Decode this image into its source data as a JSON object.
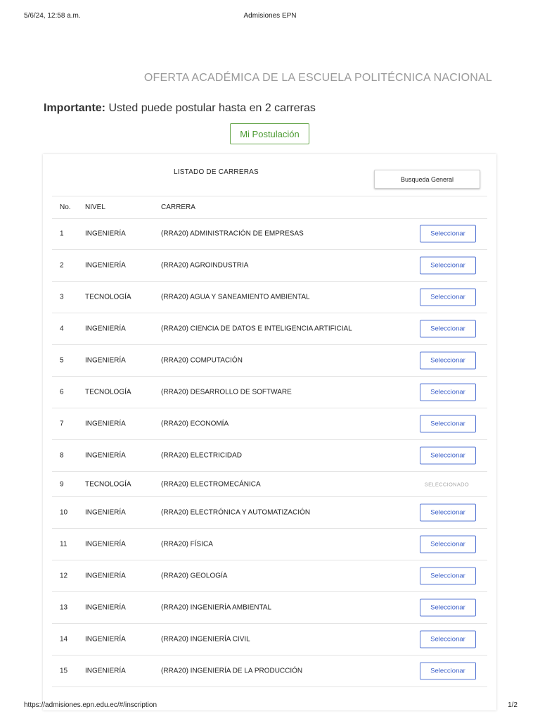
{
  "print_header": {
    "datetime": "5/6/24, 12:58 a.m.",
    "title": "Admisiones EPN"
  },
  "page_heading": "OFERTA ACADÉMICA DE LA ESCUELA POLITÉCNICA NACIONAL",
  "notice": {
    "bold": "Importante:",
    "text": " Usted puede postular hasta en 2 carreras"
  },
  "postulacion_button": "Mi Postulación",
  "card": {
    "title": "LISTADO DE CARRERAS",
    "search_button": "Busqueda General",
    "columns": {
      "no": "No.",
      "nivel": "NIVEL",
      "carrera": "CARRERA"
    },
    "select_label": "Seleccionar",
    "selected_label": "SELECCIONADO",
    "rows": [
      {
        "no": "1",
        "nivel": "INGENIERÍA",
        "carrera": "(RRA20) ADMINISTRACIÓN DE EMPRESAS",
        "selected": false
      },
      {
        "no": "2",
        "nivel": "INGENIERÍA",
        "carrera": "(RRA20) AGROINDUSTRIA",
        "selected": false
      },
      {
        "no": "3",
        "nivel": "TECNOLOGÍA",
        "carrera": "(RRA20) AGUA Y SANEAMIENTO AMBIENTAL",
        "selected": false
      },
      {
        "no": "4",
        "nivel": "INGENIERÍA",
        "carrera": "(RRA20) CIENCIA DE DATOS E INTELIGENCIA ARTIFICIAL",
        "selected": false
      },
      {
        "no": "5",
        "nivel": "INGENIERÍA",
        "carrera": "(RRA20) COMPUTACIÓN",
        "selected": false
      },
      {
        "no": "6",
        "nivel": "TECNOLOGÍA",
        "carrera": "(RRA20) DESARROLLO DE SOFTWARE",
        "selected": false
      },
      {
        "no": "7",
        "nivel": "INGENIERÍA",
        "carrera": "(RRA20) ECONOMÍA",
        "selected": false
      },
      {
        "no": "8",
        "nivel": "INGENIERÍA",
        "carrera": "(RRA20) ELECTRICIDAD",
        "selected": false
      },
      {
        "no": "9",
        "nivel": "TECNOLOGÍA",
        "carrera": "(RRA20) ELECTROMECÁNICA",
        "selected": true
      },
      {
        "no": "10",
        "nivel": "INGENIERÍA",
        "carrera": "(RRA20) ELECTRÓNICA Y AUTOMATIZACIÓN",
        "selected": false
      },
      {
        "no": "11",
        "nivel": "INGENIERÍA",
        "carrera": "(RRA20) FÍSICA",
        "selected": false
      },
      {
        "no": "12",
        "nivel": "INGENIERÍA",
        "carrera": "(RRA20) GEOLOGÍA",
        "selected": false
      },
      {
        "no": "13",
        "nivel": "INGENIERÍA",
        "carrera": "(RRA20) INGENIERÍA AMBIENTAL",
        "selected": false
      },
      {
        "no": "14",
        "nivel": "INGENIERÍA",
        "carrera": "(RRA20) INGENIERÍA CIVIL",
        "selected": false
      },
      {
        "no": "15",
        "nivel": "INGENIERÍA",
        "carrera": "(RRA20) INGENIERÍA DE LA PRODUCCIÓN",
        "selected": false
      }
    ]
  },
  "print_footer": {
    "url": "https://admisiones.epn.edu.ec/#/inscription",
    "page": "1/2"
  },
  "colors": {
    "accent_green": "#4a9a30",
    "select_blue": "#3b5fc8",
    "heading_gray": "#9a9a9a"
  }
}
